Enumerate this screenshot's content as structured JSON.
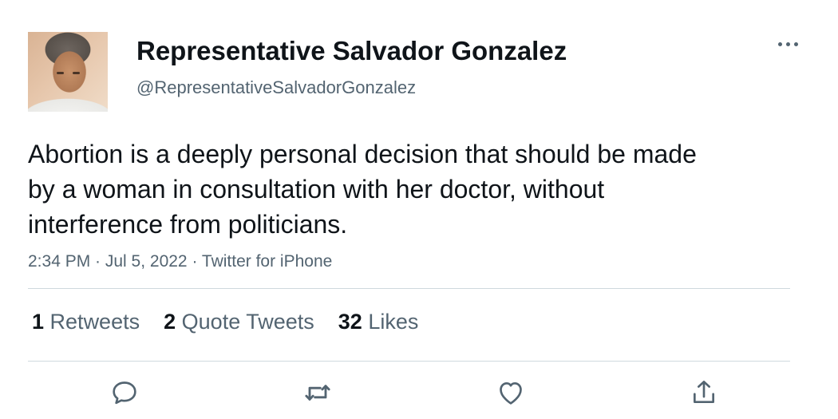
{
  "author": {
    "display_name": "Representative Salvador Gonzalez",
    "handle": "@RepresentativeSalvadorGonzalez"
  },
  "tweet": {
    "text": "Abortion is a deeply personal decision that should be made by a woman in consultation with her doctor, without interference from politicians.",
    "meta": "2:34 PM · Jul 5, 2022 · Twitter for iPhone"
  },
  "stats": {
    "retweets_count": "1",
    "retweets_label": "Retweets",
    "quote_count": "2",
    "quote_label": "Quote Tweets",
    "likes_count": "32",
    "likes_label": "Likes"
  },
  "icons": {
    "more": "more-icon",
    "reply": "reply-icon",
    "retweet": "retweet-icon",
    "like": "like-icon",
    "share": "share-icon"
  },
  "colors": {
    "text": "#0f1419",
    "secondary": "#536471",
    "divider": "#cfd9de"
  }
}
